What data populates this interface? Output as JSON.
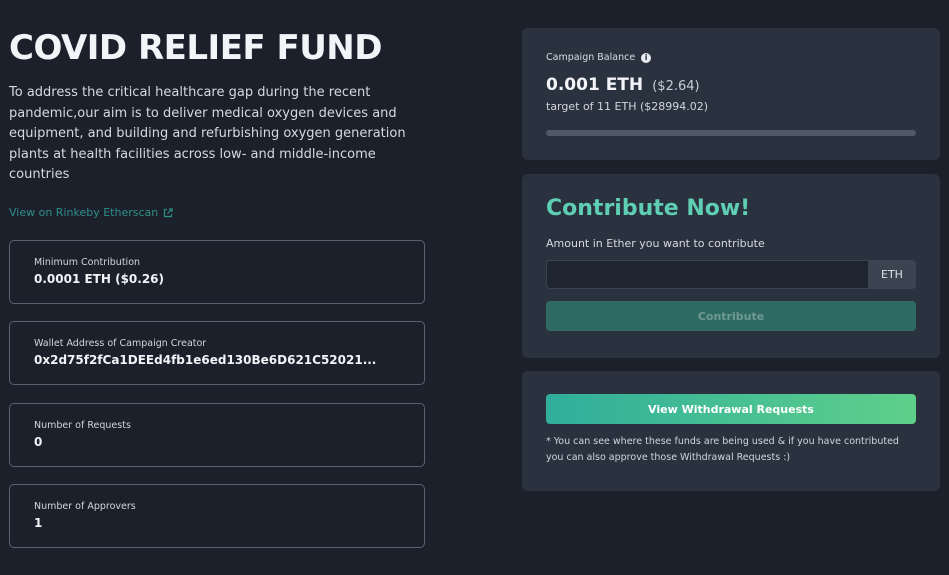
{
  "campaign": {
    "title": "COVID RELIEF FUND",
    "description": "To address the critical healthcare gap during the recent pandemic,our aim is to deliver medical oxygen devices and equipment, and building and refurbishing oxygen generation plants at health facilities across low- and middle-income countries",
    "etherscan_link": "View on Rinkeby Etherscan"
  },
  "stats": [
    {
      "label": "Minimum Contribution",
      "value": "0.0001 ETH ($0.26)"
    },
    {
      "label": "Wallet Address of Campaign Creator",
      "value": "0x2d75f2fCa1DEEd4fb1e6ed130Be6D621C52021..."
    },
    {
      "label": "Number of Requests",
      "value": "0"
    },
    {
      "label": "Number of Approvers",
      "value": "1"
    }
  ],
  "balance": {
    "label": "Campaign Balance",
    "info_icon": "info-icon",
    "eth": "0.001 ETH",
    "usd": "($2.64)",
    "target": "target of 11 ETH ($28994.02)",
    "progress_percent": 0.01
  },
  "contribute": {
    "title": "Contribute Now!",
    "amount_label": "Amount in Ether you want to contribute",
    "input_value": "",
    "unit": "ETH",
    "button_label": "Contribute"
  },
  "withdraw": {
    "button_label": "View Withdrawal Requests",
    "note": "* You can see where these funds are being used & if you have contributed you can also approve those Withdrawal Requests :)"
  },
  "colors": {
    "background": "#1b202b",
    "card": "#2a323f",
    "accent": "#5fcfb3",
    "link": "#2f8f88"
  }
}
